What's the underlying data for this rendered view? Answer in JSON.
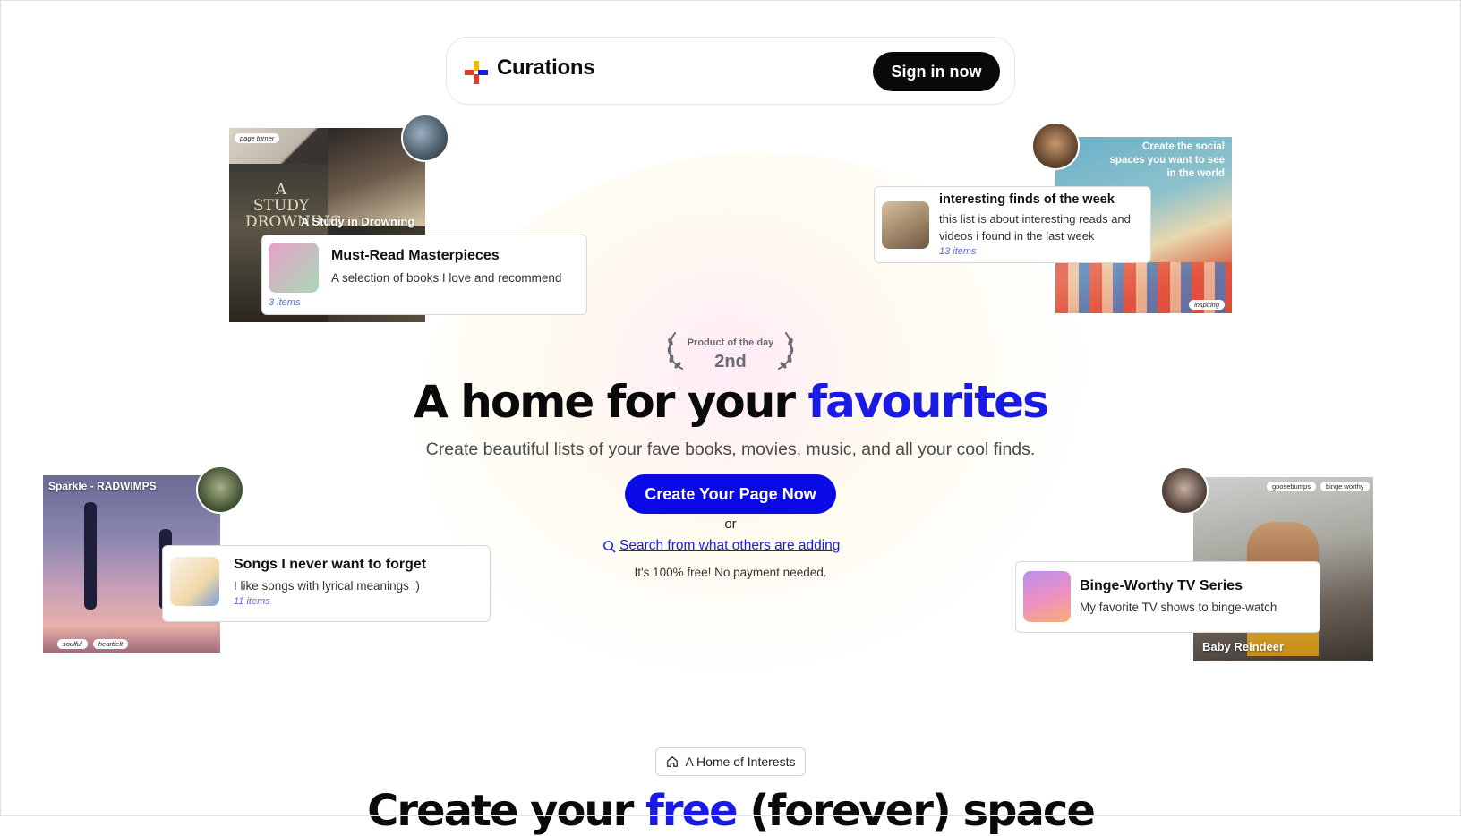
{
  "header": {
    "logo_text": "Curations",
    "signin_label": "Sign in now"
  },
  "showcase": {
    "books": {
      "tag": "page turner",
      "photo_label": "A Study in Drowning",
      "title": "Must-Read Masterpieces",
      "desc": "A selection of books I love and recommend",
      "count": "3 items"
    },
    "finds": {
      "photo_text": "Create the social spaces you want to see in the world",
      "tag": "inspiring",
      "title": "interesting finds of the week",
      "desc": "this list is about interesting reads and videos i found in the last week",
      "count": "13 items"
    },
    "songs": {
      "photo_label": "Sparkle - RADWIMPS",
      "tags": [
        "soulful",
        "heartfelt"
      ],
      "title": "Songs I never want to forget",
      "desc": "I like songs with lyrical meanings :)",
      "count": "11 items"
    },
    "tv": {
      "tags": [
        "goosebumps",
        "binge worthy"
      ],
      "photo_label": "Baby Reindeer",
      "title": "Binge-Worthy TV Series",
      "desc": "My favorite TV shows to binge-watch"
    }
  },
  "badge": {
    "label": "Product of the day",
    "rank": "2nd"
  },
  "hero": {
    "title_main": "A home for your ",
    "title_accent": "favourites",
    "subtitle": "Create beautiful lists of your fave books, movies, music, and all your cool finds.",
    "cta_label": "Create Your Page Now",
    "or_text": "or",
    "search_link": "Search from what others are adding",
    "free_note": "It's 100% free! No payment needed."
  },
  "section2": {
    "pill_label": "A Home of Interests",
    "heading_start": "Create your ",
    "heading_accent": "free",
    "heading_end": " (forever) space"
  },
  "colors": {
    "accent": "#1a1ae6",
    "cta": "#0a0ae6",
    "dark": "#0a0a0a",
    "count_text": "#5e6bd8"
  }
}
